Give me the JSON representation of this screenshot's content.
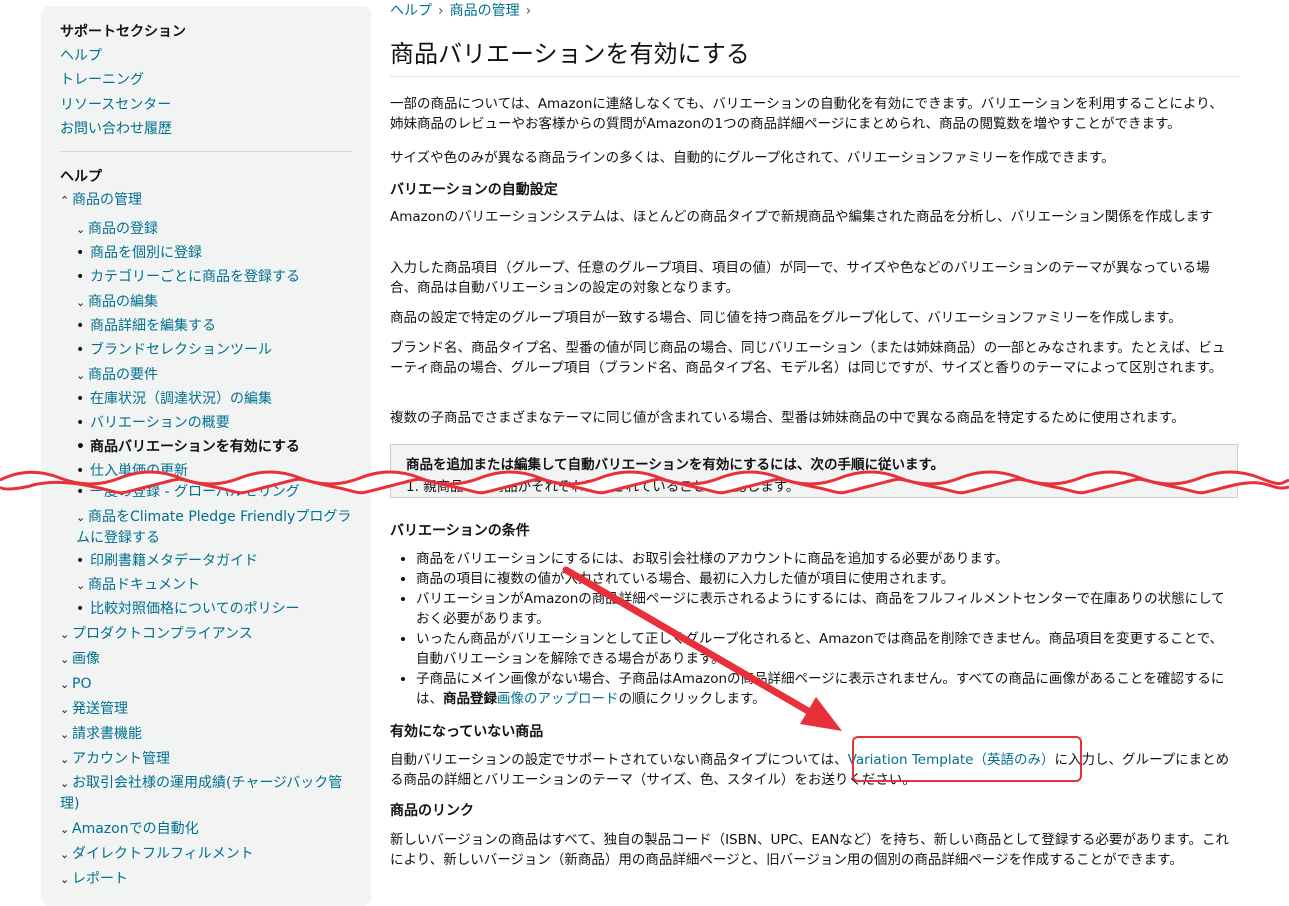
{
  "sidebar": {
    "support_title": "サポートセクション",
    "support_links": [
      "ヘルプ",
      "トレーニング",
      "リソースセンター",
      "お問い合わせ履歴"
    ],
    "help_title": "ヘルプ",
    "nav": [
      "商品の管理",
      "商品の登録",
      "商品を個別に登録",
      "カテゴリーごとに商品を登録する",
      "商品の編集",
      "商品詳細を編集する",
      "ブランドセレクションツール",
      "商品の要件",
      "在庫状況（調達状況）の編集",
      "バリエーションの概要",
      "商品バリエーションを有効にする",
      "仕入単価の更新",
      "一度の登録 - グローバルセリング",
      "商品をClimate Pledge Friendlyプログラムに登録する",
      "印刷書籍メタデータガイド",
      "商品ドキュメント",
      "比較対照価格についてのポリシー",
      "プロダクトコンプライアンス",
      "画像",
      "PO",
      "発送管理",
      "請求書機能",
      "アカウント管理",
      "お取引会社様の運用成績(チャージバック管理)",
      "Amazonでの自動化",
      "ダイレクトフルフィルメント",
      "レポート"
    ]
  },
  "main": {
    "breadcrumb": [
      "ヘルプ",
      "商品の管理"
    ],
    "title": "商品バリエーションを有効にする",
    "intro1": "一部の商品については、Amazonに連絡しなくても、バリエーションの自動化を有効にできます。バリエーションを利用することにより、姉妹商品のレビューやお客様からの質問がAmazonの1つの商品詳細ページにまとめられ、商品の閲覧数を増やすことができます。",
    "intro2": "サイズや色のみが異なる商品ラインの多くは、自動的にグループ化されて、バリエーションファミリーを作成できます。",
    "h_auto": "バリエーションの自動設定",
    "auto1": "Amazonのバリエーションシステムは、ほとんどの商品タイプで新規商品や編集された商品を分析し、バリエーション関係を作成します",
    "auto2": "入力した商品項目（グループ、任意のグループ項目、項目の値）が同一で、サイズや色などのバリエーションのテーマが異なっている場合、商品は自動バリエーションの設定の対象となります。",
    "auto3": "商品の設定で特定のグループ項目が一致する場合、同じ値を持つ商品をグループ化して、バリエーションファミリーを作成します。",
    "auto4": "ブランド名、商品タイプ名、型番の値が同じ商品の場合、同じバリエーション（または姉妹商品）の一部とみなされます。たとえば、ビューティ商品の場合、グループ項目（ブランド名、商品タイプ名、モデル名）は同じですが、サイズと香りのテーマによって区別されます。",
    "auto5": "複数の子商品でさまざまなテーマに同じ値が含まれている場合、型番は姉妹商品の中で異なる商品を特定するために使用されます。",
    "callout_title": "商品を追加または編集して自動バリエーションを有効にするには、次の手順に従います。",
    "callout_sub": "1. 親商品と子商品がそれぞれ登録されていることを確認します。",
    "h_cond": "バリエーションの条件",
    "cond": [
      "商品をバリエーションにするには、お取引会社様のアカウントに商品を追加する必要があります。",
      "商品の項目に複数の値が入力されている場合、最初に入力した値が項目に使用されます。",
      "バリエーションがAmazonの商品詳細ページに表示されるようにするには、商品をフルフィルメントセンターで在庫ありの状態にしておく必要があります。",
      "いったん商品がバリエーションとして正しくグループ化されると、Amazonでは商品を削除できません。商品項目を変更することで、自動バリエーションを解除できる場合があります。"
    ],
    "cond5_pre": "子商品にメイン画像がない場合、子商品はAmazonの商品詳細ページに表示されません。すべての商品に画像があることを確認するには、",
    "cond5_bold": "商品登録",
    "cond5_link": "画像のアップロード",
    "cond5_post": "の順にクリックします。",
    "h_inactive": "有効になっていない商品",
    "inactive_pre": "自動バリエーションの設定でサポートされていない商品タイプについては、",
    "inactive_link": "Variation Template（英語のみ）",
    "inactive_post": "に入力し、グループにまとめる商品の詳細とバリエーションのテーマ（サイズ、色、スタイル）をお送りください。",
    "h_links": "商品のリンク",
    "links1": "新しいバージョンの商品はすべて、独自の製品コード（ISBN、UPC、EANなど）を持ち、新しい商品として登録する必要があります。これにより、新しいバージョン（新商品）用の商品詳細ページと、旧バージョン用の個別の商品詳細ページを作成することができます。"
  },
  "colors": {
    "link": "#00708f",
    "annotation": "#e8303a",
    "sidebar_bg": "#f2f3f3"
  }
}
